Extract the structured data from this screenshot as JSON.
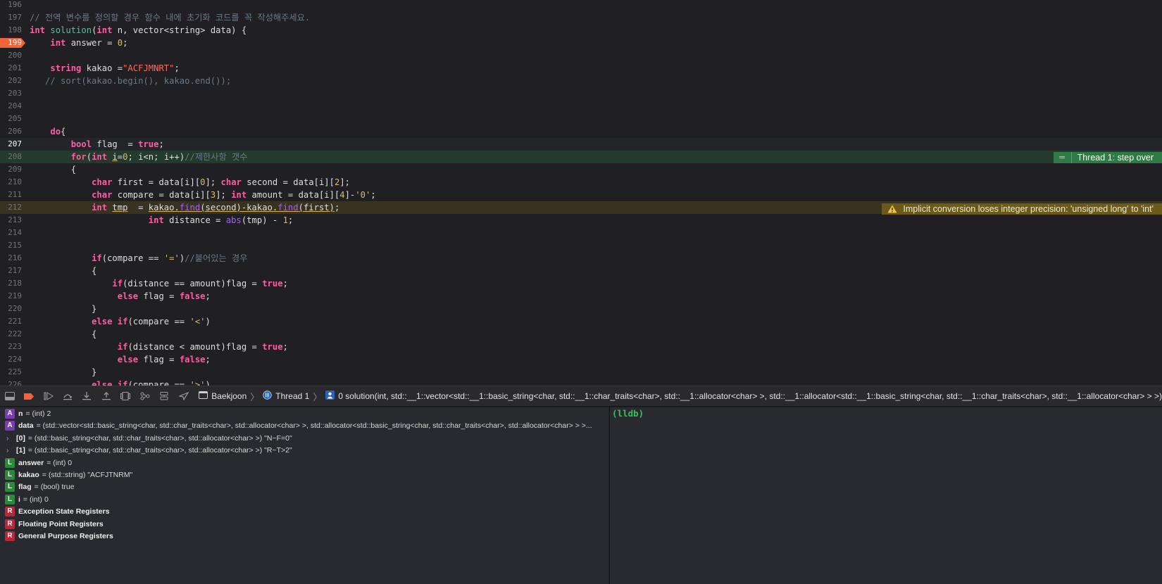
{
  "editor": {
    "lines": [
      {
        "num": "196",
        "segs": []
      },
      {
        "num": "197",
        "segs": [
          {
            "c": "cmt",
            "t": "// 전역 변수를 정의할 경우 함수 내에 초기화 코드를 꼭 작성해주세요."
          }
        ]
      },
      {
        "num": "198",
        "segs": [
          {
            "c": "kw",
            "t": "int"
          },
          {
            "c": "",
            "t": " "
          },
          {
            "c": "fn",
            "t": "solution"
          },
          {
            "c": "",
            "t": "("
          },
          {
            "c": "kw",
            "t": "int"
          },
          {
            "c": "",
            "t": " n, vector<string> data) {"
          }
        ]
      },
      {
        "num": "199",
        "bp": true,
        "segs": [
          {
            "c": "",
            "t": "    "
          },
          {
            "c": "kw",
            "t": "int"
          },
          {
            "c": "",
            "t": " answer = "
          },
          {
            "c": "num",
            "t": "0"
          },
          {
            "c": "",
            "t": ";"
          }
        ]
      },
      {
        "num": "200",
        "segs": []
      },
      {
        "num": "201",
        "segs": [
          {
            "c": "",
            "t": "    "
          },
          {
            "c": "kw",
            "t": "string"
          },
          {
            "c": "",
            "t": " kakao ="
          },
          {
            "c": "str",
            "t": "\"ACFJMNRT\""
          },
          {
            "c": "",
            "t": ";"
          }
        ]
      },
      {
        "num": "202",
        "segs": [
          {
            "c": "cmt",
            "t": "   // sort(kakao.begin(), kakao.end());"
          }
        ]
      },
      {
        "num": "203",
        "segs": []
      },
      {
        "num": "204",
        "segs": []
      },
      {
        "num": "205",
        "segs": []
      },
      {
        "num": "206",
        "segs": [
          {
            "c": "",
            "t": "    "
          },
          {
            "c": "kw",
            "t": "do"
          },
          {
            "c": "",
            "t": "{"
          }
        ]
      },
      {
        "num": "207",
        "cur": true,
        "segs": [
          {
            "c": "",
            "t": "        "
          },
          {
            "c": "kw",
            "t": "bool"
          },
          {
            "c": "",
            "t": " flag  = "
          },
          {
            "c": "kw",
            "t": "true"
          },
          {
            "c": "",
            "t": ";"
          }
        ]
      },
      {
        "num": "208",
        "step": true,
        "segs": [
          {
            "c": "",
            "t": "        "
          },
          {
            "c": "kw",
            "t": "for"
          },
          {
            "c": "",
            "t": "("
          },
          {
            "c": "kw",
            "t": "int"
          },
          {
            "c": "",
            "t": " "
          },
          {
            "c": "uline",
            "t": "i"
          },
          {
            "c": "",
            "t": "="
          },
          {
            "c": "num",
            "t": "0"
          },
          {
            "c": "",
            "t": "; i<n; i++)"
          },
          {
            "c": "cmt",
            "t": "//제한사항 갯수"
          }
        ]
      },
      {
        "num": "209",
        "segs": [
          {
            "c": "",
            "t": "        {"
          }
        ]
      },
      {
        "num": "210",
        "segs": [
          {
            "c": "",
            "t": "            "
          },
          {
            "c": "kw",
            "t": "char"
          },
          {
            "c": "",
            "t": " first = data[i]["
          },
          {
            "c": "num",
            "t": "0"
          },
          {
            "c": "",
            "t": "]; "
          },
          {
            "c": "kw",
            "t": "char"
          },
          {
            "c": "",
            "t": " second = data[i]["
          },
          {
            "c": "num",
            "t": "2"
          },
          {
            "c": "",
            "t": "];"
          }
        ]
      },
      {
        "num": "211",
        "segs": [
          {
            "c": "",
            "t": "            "
          },
          {
            "c": "kw",
            "t": "char"
          },
          {
            "c": "",
            "t": " compare = data[i]["
          },
          {
            "c": "num",
            "t": "3"
          },
          {
            "c": "",
            "t": "]; "
          },
          {
            "c": "kw",
            "t": "int"
          },
          {
            "c": "",
            "t": " amount = data[i]["
          },
          {
            "c": "num",
            "t": "4"
          },
          {
            "c": "",
            "t": "]-"
          },
          {
            "c": "chr",
            "t": "'0'"
          },
          {
            "c": "",
            "t": ";"
          }
        ]
      },
      {
        "num": "212",
        "warn": true,
        "segs": [
          {
            "c": "",
            "t": "            "
          },
          {
            "c": "kw",
            "t": "int"
          },
          {
            "c": "",
            "t": " "
          },
          {
            "c": "uline",
            "t": "tmp"
          },
          {
            "c": "",
            "t": "  = "
          },
          {
            "c": "uline",
            "t": "kakao."
          },
          {
            "c": "uline mth",
            "t": "find"
          },
          {
            "c": "uline",
            "t": "(second)-kakao."
          },
          {
            "c": "uline mth",
            "t": "find"
          },
          {
            "c": "uline",
            "t": "(first)"
          },
          {
            "c": "",
            "t": ";"
          }
        ]
      },
      {
        "num": "213",
        "segs": [
          {
            "c": "",
            "t": "                       "
          },
          {
            "c": "kw",
            "t": "int"
          },
          {
            "c": "",
            "t": " distance = "
          },
          {
            "c": "mth",
            "t": "abs"
          },
          {
            "c": "",
            "t": "(tmp) - "
          },
          {
            "c": "num",
            "t": "1"
          },
          {
            "c": "",
            "t": ";"
          }
        ]
      },
      {
        "num": "214",
        "segs": []
      },
      {
        "num": "215",
        "segs": []
      },
      {
        "num": "216",
        "segs": [
          {
            "c": "",
            "t": "            "
          },
          {
            "c": "kw",
            "t": "if"
          },
          {
            "c": "",
            "t": "(compare == "
          },
          {
            "c": "chr",
            "t": "'='"
          },
          {
            "c": "",
            "t": ")"
          },
          {
            "c": "cmt",
            "t": "//붙어있는 경우"
          }
        ]
      },
      {
        "num": "217",
        "segs": [
          {
            "c": "",
            "t": "            {"
          }
        ]
      },
      {
        "num": "218",
        "segs": [
          {
            "c": "",
            "t": "                "
          },
          {
            "c": "kw",
            "t": "if"
          },
          {
            "c": "",
            "t": "(distance == amount)flag = "
          },
          {
            "c": "kw",
            "t": "true"
          },
          {
            "c": "",
            "t": ";"
          }
        ]
      },
      {
        "num": "219",
        "segs": [
          {
            "c": "",
            "t": "                 "
          },
          {
            "c": "kw",
            "t": "else"
          },
          {
            "c": "",
            "t": " flag = "
          },
          {
            "c": "kw",
            "t": "false"
          },
          {
            "c": "",
            "t": ";"
          }
        ]
      },
      {
        "num": "220",
        "segs": [
          {
            "c": "",
            "t": "            }"
          }
        ]
      },
      {
        "num": "221",
        "segs": [
          {
            "c": "",
            "t": "            "
          },
          {
            "c": "kw",
            "t": "else if"
          },
          {
            "c": "",
            "t": "(compare == "
          },
          {
            "c": "chr",
            "t": "'<'"
          },
          {
            "c": "",
            "t": ")"
          }
        ]
      },
      {
        "num": "222",
        "segs": [
          {
            "c": "",
            "t": "            {"
          }
        ]
      },
      {
        "num": "223",
        "segs": [
          {
            "c": "",
            "t": "                 "
          },
          {
            "c": "kw",
            "t": "if"
          },
          {
            "c": "",
            "t": "(distance < amount)flag = "
          },
          {
            "c": "kw",
            "t": "true"
          },
          {
            "c": "",
            "t": ";"
          }
        ]
      },
      {
        "num": "224",
        "segs": [
          {
            "c": "",
            "t": "                 "
          },
          {
            "c": "kw",
            "t": "else"
          },
          {
            "c": "",
            "t": " flag = "
          },
          {
            "c": "kw",
            "t": "false"
          },
          {
            "c": "",
            "t": ";"
          }
        ]
      },
      {
        "num": "225",
        "segs": [
          {
            "c": "",
            "t": "            }"
          }
        ]
      },
      {
        "num": "226",
        "segs": [
          {
            "c": "",
            "t": "            "
          },
          {
            "c": "kw",
            "t": "else if"
          },
          {
            "c": "",
            "t": "(compare == "
          },
          {
            "c": "chr",
            "t": "'>'"
          },
          {
            "c": "",
            "t": ")"
          }
        ]
      }
    ],
    "step_badge": "Thread 1: step over",
    "warn_badge": "Implicit conversion loses integer precision: 'unsigned long' to 'int'"
  },
  "debugbar": {
    "buttons": [
      "hide-panel-icon",
      "breakpoints-icon",
      "continue-icon",
      "step-over-icon",
      "step-into-icon",
      "step-out-icon",
      "view-hierarchy-icon",
      "memory-graph-icon",
      "environment-icon",
      "location-icon"
    ],
    "breadcrumb": {
      "target": "Baekjoon",
      "thread": "Thread 1",
      "frame": "0 solution(int, std::__1::vector<std::__1::basic_string<char, std::__1::char_traits<char>, std::__1::allocator<char> >, std::__1::allocator<std::__1::basic_string<char, std::__1::char_traits<char>, std::__1::allocator<char> > >)"
    }
  },
  "variables": [
    {
      "tag": "A",
      "name": "n",
      "value": "= (int) 2"
    },
    {
      "tag": "A",
      "name": "data",
      "value": "= (std::vector<std::basic_string<char, std::char_traits<char>, std::allocator<char> >, std::allocator<std::basic_string<char, std::char_traits<char>, std::allocator<char> > >..."
    },
    {
      "tag": ">",
      "name": "[0]",
      "value": "= (std::basic_string<char, std::char_traits<char>, std::allocator<char> >) \"N~F=0\""
    },
    {
      "tag": ">",
      "name": "[1]",
      "value": "= (std::basic_string<char, std::char_traits<char>, std::allocator<char> >) \"R~T>2\""
    },
    {
      "tag": "L",
      "name": "answer",
      "value": "= (int) 0"
    },
    {
      "tag": "L",
      "name": "kakao",
      "value": "= (std::string) \"ACFJTNRM\""
    },
    {
      "tag": "L",
      "name": "flag",
      "value": "= (bool) true"
    },
    {
      "tag": "L",
      "name": "i",
      "value": "= (int) 0"
    },
    {
      "tag": "R",
      "name": "Exception State Registers",
      "value": ""
    },
    {
      "tag": "R",
      "name": "Floating Point Registers",
      "value": ""
    },
    {
      "tag": "R",
      "name": "General Purpose Registers",
      "value": ""
    }
  ],
  "console": {
    "prompt": "(lldb)"
  },
  "colors": {
    "breakpoint": "#f0643a",
    "step_badge": "#2f7a45",
    "warn_badge": "#6b5a1b",
    "prompt": "#39c153"
  }
}
